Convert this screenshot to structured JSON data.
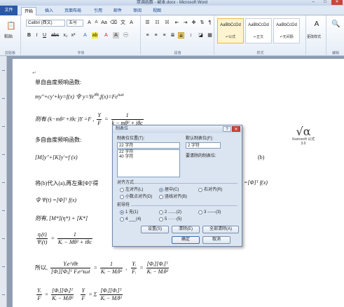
{
  "window": {
    "title": "双调函数 - 副本.docx - Microsoft Word",
    "min": "–",
    "max": "□",
    "close": "✕"
  },
  "tabs": [
    "文件",
    "开始",
    "插入",
    "页面布局",
    "引用",
    "邮件",
    "审阅",
    "视图"
  ],
  "ribbon": {
    "clipboard": {
      "paste": "粘贴",
      "label": "剪贴板"
    },
    "font": {
      "name": "Calibri (西文)",
      "size": "五号",
      "label": "字体"
    },
    "paragraph": {
      "label": "段落"
    },
    "styles": {
      "items": [
        {
          "sample": "AaBbCcDd",
          "name": "↵公式"
        },
        {
          "sample": "AaBbCcDd",
          "name": "↵正文"
        },
        {
          "sample": "AaBbCcDd",
          "name": "↵无间隔"
        }
      ],
      "change": "更改样式",
      "label": "样式"
    },
    "edit": {
      "label": "编辑"
    }
  },
  "doc": {
    "l1": "单自由度频响函数:",
    "l2": "my″+cy′+ky=f(x)   令  y=Ye",
    "l2b": "iθt",
    "l2c": ",f(x)=Fe",
    "l2d": "iωt",
    "l3a": "则有 (k−mθ² +iθc )Y =F ,",
    "l3f_num": "Y",
    "l3f_den": "F",
    "l3eq": "=",
    "l3r_num": "1",
    "l3r_den": "k − mθ² + iθc",
    "l4": "多自由度频响函数:",
    "l5": "[M]y″+[K]y′=f (x)",
    "l5r": "(b)",
    "l6": "将(b)代入(a),再左乘[Φ]ᵀ得",
    "l6r": "=[Φ]ᵀ f(x)",
    "l7": "令   Ψ(t) =[Φ]ᵀ f(x)",
    "l8": "则有,  [M*](η*) + [K*]",
    "l9a_num": "ηᵢ(t)",
    "l9a_den": "Ψᵢ(t)",
    "l9eq": "=",
    "l9b_num": "1",
    "l9b_den": "Kᵢ − Mθ² + iθc",
    "l10pre": "所以,",
    "l10a_num": "Yᵢe^iθt",
    "l10a_den": "[Φᵢ][Φᵢ]ᵀ Fᵢe^iωt",
    "l10eq": "=",
    "l10b_num": "1",
    "l10b_den": "Kᵢ − Mᵢθ²",
    "l10c_num": "Yᵢ",
    "l10c_den": "Fᵢ",
    "l10d_num": "[Φᵢ][Φᵢ]ᵀ",
    "l10d_den": "Kᵢ − Mᵢθ²",
    "l11a_num": "Yᵢ",
    "l11a_den": "F",
    "l11b_num": "[Φᵢ][Φᵢ]ᵀ",
    "l11b_den": "Kᵢ − Mᵢθ²",
    "l11c_num": "Y",
    "l11c_den": "F",
    "l11sum": "= Σ",
    "l11d_num": "[Φᵢ][Φᵢ]ᵀ",
    "l11d_den": "Kᵢ − Mᵢθ²",
    "para": "↵"
  },
  "mathtype": {
    "caption1": "Xsoroocft 公式",
    "caption2": "3.0"
  },
  "dialog": {
    "title": "制表位",
    "help": "?",
    "close": "✕",
    "tab_pos_label": "制表位位置(T):",
    "tab_pos_value": "22 字符",
    "tab_list": [
      "22 字符",
      "40 字符"
    ],
    "default_label": "默认制表位(F):",
    "default_value": "2 字符",
    "clear_label": "要清除的制表位:",
    "align_label": "对齐方式",
    "align": [
      "左对齐(L)",
      "居中(C)",
      "右对齐(R)",
      "小数点对齐(D)",
      "竖线对齐(B)"
    ],
    "leader_label": "前导符",
    "leader": [
      "1 无(1)",
      "2 .......(2)",
      "3 ------(3)",
      "4 ___(4)",
      "5 ······(5)"
    ],
    "btn_set": "设置(S)",
    "btn_clear": "清除(E)",
    "btn_clear_all": "全部清除(A)",
    "btn_ok": "确定",
    "btn_cancel": "取消"
  }
}
